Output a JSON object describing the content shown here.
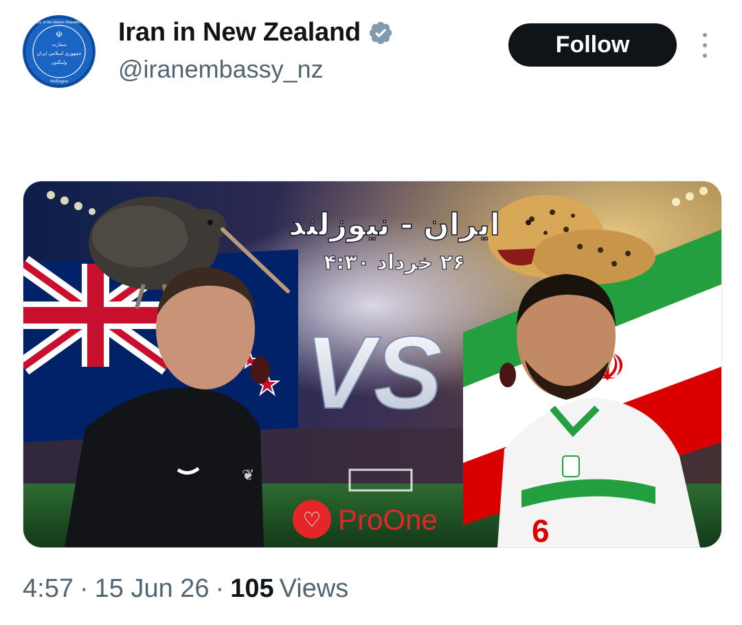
{
  "header": {
    "display_name": "Iran in New Zealand",
    "handle": "@iranembassy_nz",
    "follow_label": "Follow",
    "verified_icon": "verified-badge-icon",
    "avatar_ring_text": "Embassy of the Islamic Republic of Iran",
    "avatar_center_text_line1": "سفارت",
    "avatar_center_text_line2": "جمهوری اسلامی ایران",
    "avatar_center_text_line3": "ولینگتون",
    "avatar_bottom_text": "Wellington"
  },
  "media": {
    "title_fa": "ایران - نیوزلند",
    "date_fa": "۲۶ خرداد ۴:۳۰",
    "vs_text": "VS",
    "brand_text": "ProOne",
    "jersey_number": "6",
    "colors": {
      "iran_green": "#239f40",
      "iran_red": "#da0000",
      "nz_blue": "#012169",
      "brand_red": "#e52629"
    }
  },
  "meta": {
    "time": "4:57",
    "separator": "·",
    "date": "15 Jun 26",
    "views_count": "105",
    "views_label": "Views"
  }
}
